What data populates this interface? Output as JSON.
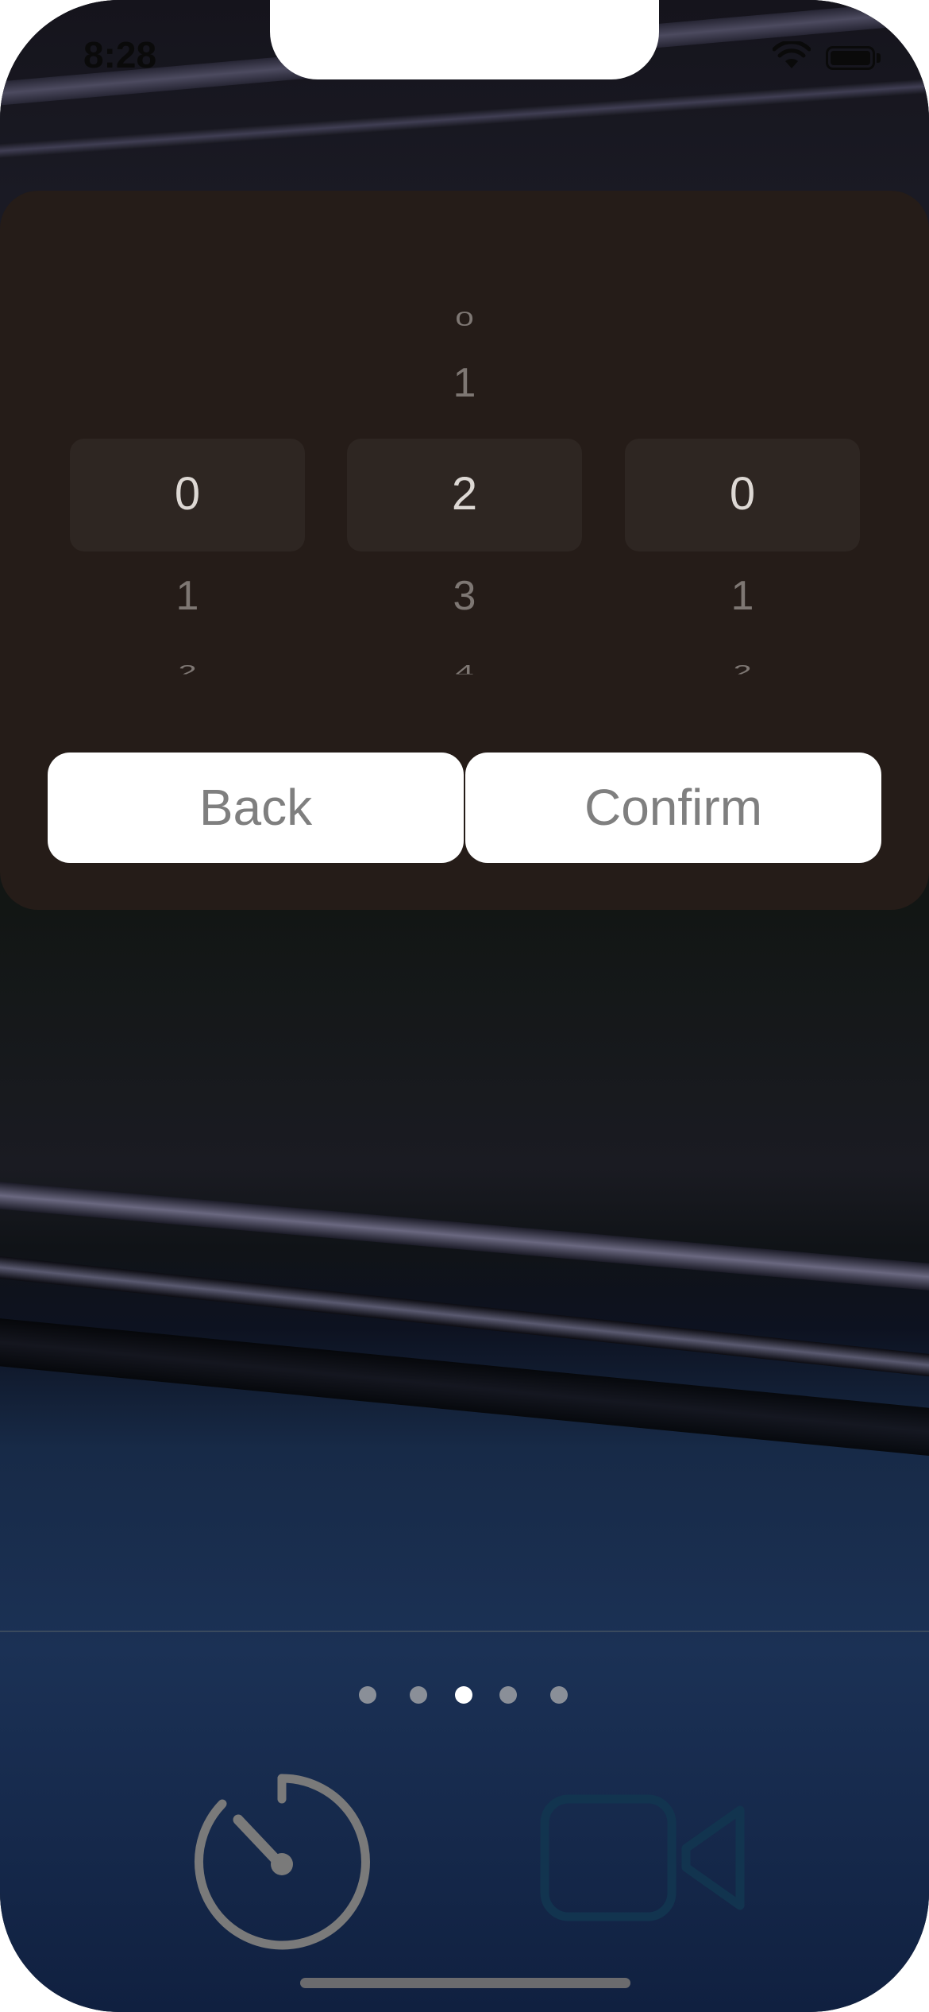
{
  "status_bar": {
    "time": "8:28"
  },
  "picker": {
    "columns": [
      {
        "above": [
          "",
          ""
        ],
        "selected": "0",
        "below": [
          "1",
          "2"
        ]
      },
      {
        "above": [
          "0",
          "1"
        ],
        "selected": "2",
        "below": [
          "3",
          "4"
        ]
      },
      {
        "above": [
          "",
          ""
        ],
        "selected": "0",
        "below": [
          "1",
          "2"
        ]
      }
    ]
  },
  "buttons": {
    "back_label": "Back",
    "confirm_label": "Confirm"
  },
  "page_indicator": {
    "count": 5,
    "active_index": 2
  },
  "tab_bar": {
    "items": [
      {
        "icon": "timer-icon",
        "color": "#7a7a7a"
      },
      {
        "icon": "video-camera-icon",
        "color": "#12344f"
      }
    ]
  },
  "colors": {
    "panel": "#251c18",
    "selection": "#2e2622",
    "button_bg": "#ffffff",
    "button_text": "#7f7f7f"
  }
}
